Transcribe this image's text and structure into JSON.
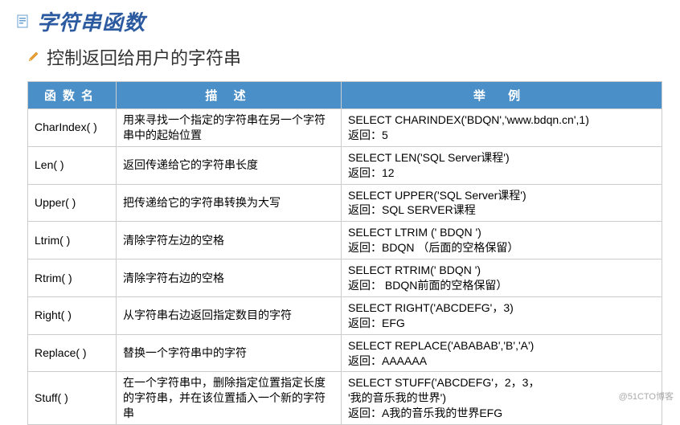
{
  "title": "字符串函数",
  "subtitle": "控制返回给用户的字符串",
  "headers": {
    "name": "函数名",
    "desc": "描 述",
    "example": "举 例"
  },
  "rows": [
    {
      "name": "CharIndex( )",
      "desc": "用来寻找一个指定的字符串在另一个字符串中的起始位置",
      "example": "SELECT CHARINDEX('BDQN','www.bdqn.cn',1)\n返回：5"
    },
    {
      "name": "Len( )",
      "desc": "返回传递给它的字符串长度",
      "example": "SELECT LEN('SQL Server课程')\n返回：12"
    },
    {
      "name": "Upper( )",
      "desc": "把传递给它的字符串转换为大写",
      "example": "SELECT UPPER('SQL Server课程')\n返回：SQL SERVER课程"
    },
    {
      "name": "Ltrim( )",
      "desc": "清除字符左边的空格",
      "example": "SELECT LTRIM ('  BDQN  ')\n返回：BDQN    （后面的空格保留）"
    },
    {
      "name": "Rtrim( )",
      "desc": "清除字符右边的空格",
      "example": "SELECT RTRIM('  BDQN  ')\n返回：    BDQN前面的空格保留）"
    },
    {
      "name": "Right( )",
      "desc": "从字符串右边返回指定数目的字符",
      "example": "SELECT RIGHT('ABCDEFG'，3)\n返回：EFG"
    },
    {
      "name": "Replace( )",
      "desc": "替换一个字符串中的字符",
      "example": "SELECT REPLACE('ABABAB','B','A')\n返回：AAAAAA"
    },
    {
      "name": "Stuff( )",
      "desc": "在一个字符串中，删除指定位置指定长度的字符串，并在该位置插入一个新的字符串",
      "example": "SELECT STUFF('ABCDEFG'，2，3，\n                           '我的音乐我的世界')\n返回：A我的音乐我的世界EFG"
    }
  ],
  "watermark": "@51CTO博客"
}
